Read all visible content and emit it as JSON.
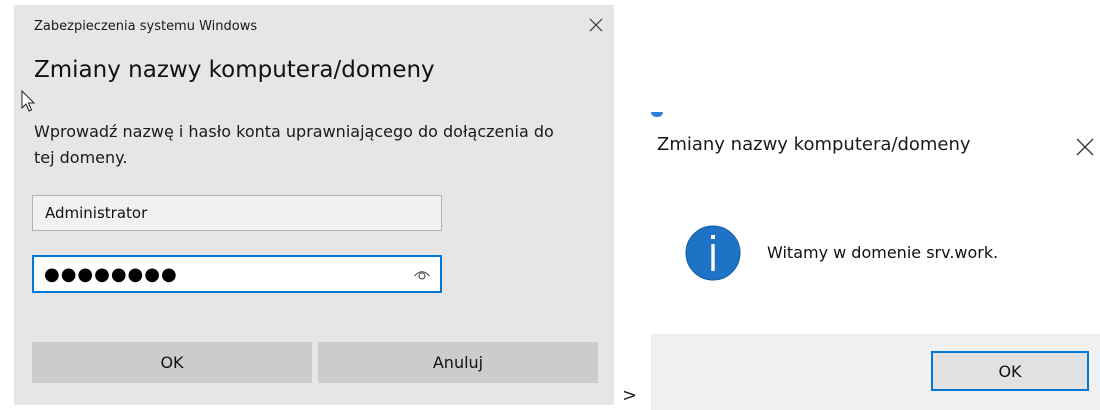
{
  "credential_dialog": {
    "caption": "Zabezpieczenia systemu Windows",
    "title": "Zmiany nazwy komputera/domeny",
    "description": "Wprowadź nazwę i hasło konta uprawniającego do dołączenia do tej domeny.",
    "username_value": "Administrator",
    "password_masked": "●●●●●●●●",
    "ok_label": "OK",
    "cancel_label": "Anuluj",
    "icons": {
      "close": "close-icon",
      "reveal": "eye-icon",
      "cursor": "mouse-pointer-icon"
    },
    "colors": {
      "background": "#e6e6e6",
      "focus_border": "#0078d7",
      "button": "#cccccc"
    }
  },
  "separator": {
    "text": ">"
  },
  "message_dialog": {
    "title": "Zmiany nazwy komputera/domeny",
    "message": "Witamy w domenie srv.work.",
    "ok_label": "OK",
    "icons": {
      "info": "info-icon",
      "close": "close-icon"
    },
    "colors": {
      "info_icon": "#1e73c7",
      "default_button_border": "#0078d7",
      "footer": "#f0f0f0"
    }
  }
}
